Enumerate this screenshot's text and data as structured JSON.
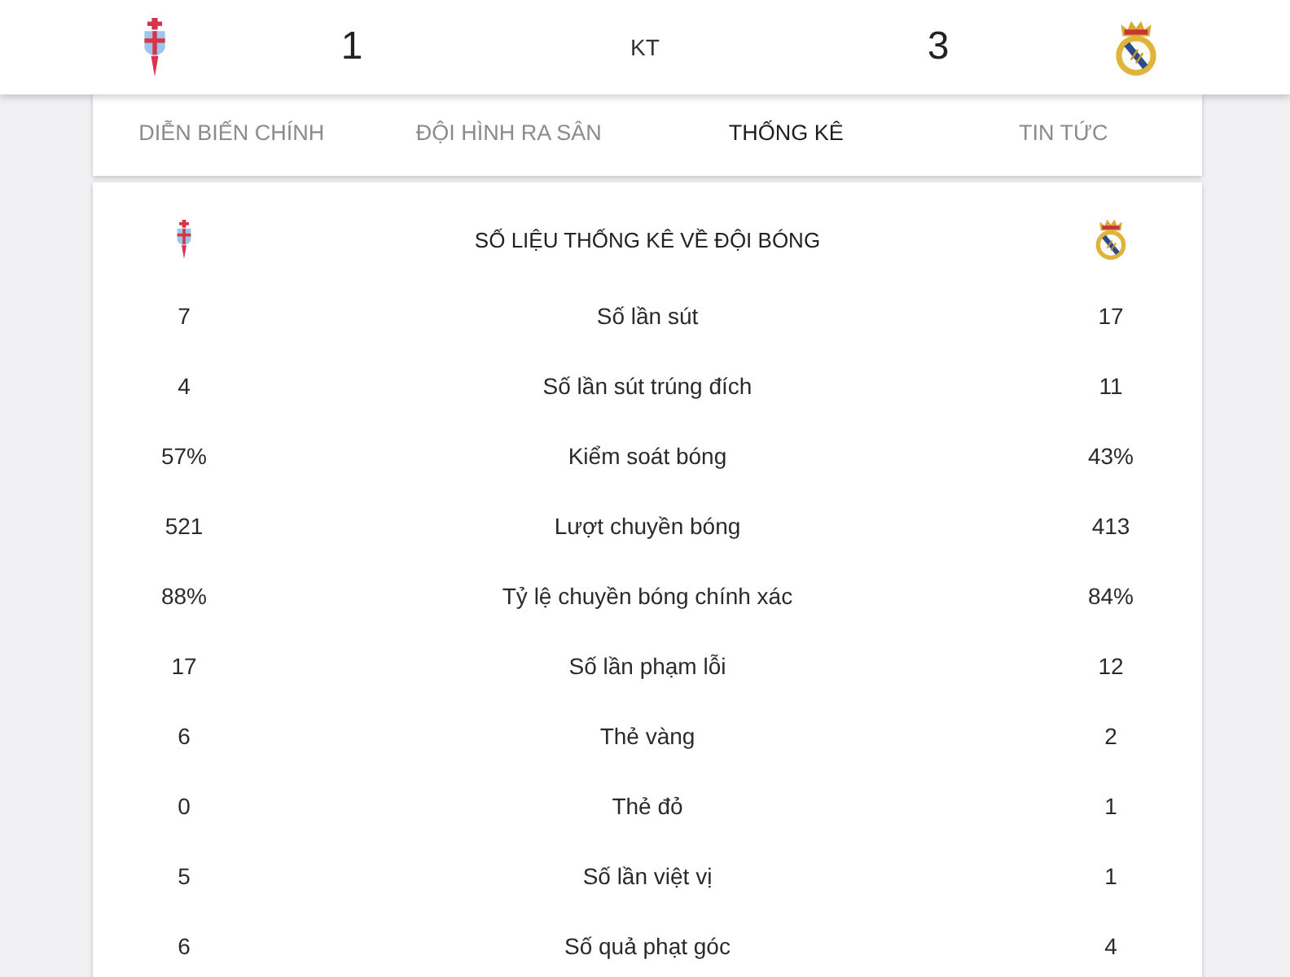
{
  "header": {
    "home_score": "1",
    "status": "KT",
    "away_score": "3"
  },
  "tabs": [
    {
      "label": "DIỄN BIẾN CHÍNH",
      "selected": false
    },
    {
      "label": "ĐỘI HÌNH RA SÂN",
      "selected": false
    },
    {
      "label": "THỐNG KÊ",
      "selected": true
    },
    {
      "label": "TIN TỨC",
      "selected": false
    }
  ],
  "stats": {
    "title": "SỐ LIỆU THỐNG KÊ VỀ ĐỘI BÓNG",
    "rows": [
      {
        "home": "7",
        "label": "Số lần sút",
        "away": "17"
      },
      {
        "home": "4",
        "label": "Số lần sút trúng đích",
        "away": "11"
      },
      {
        "home": "57%",
        "label": "Kiểm soát bóng",
        "away": "43%"
      },
      {
        "home": "521",
        "label": "Lượt chuyền bóng",
        "away": "413"
      },
      {
        "home": "88%",
        "label": "Tỷ lệ chuyền bóng chính xác",
        "away": "84%"
      },
      {
        "home": "17",
        "label": "Số lần phạm lỗi",
        "away": "12"
      },
      {
        "home": "6",
        "label": "Thẻ vàng",
        "away": "2"
      },
      {
        "home": "0",
        "label": "Thẻ đỏ",
        "away": "1"
      },
      {
        "home": "5",
        "label": "Số lần việt vị",
        "away": "1"
      },
      {
        "home": "6",
        "label": "Số quả phạt góc",
        "away": "4"
      }
    ]
  }
}
